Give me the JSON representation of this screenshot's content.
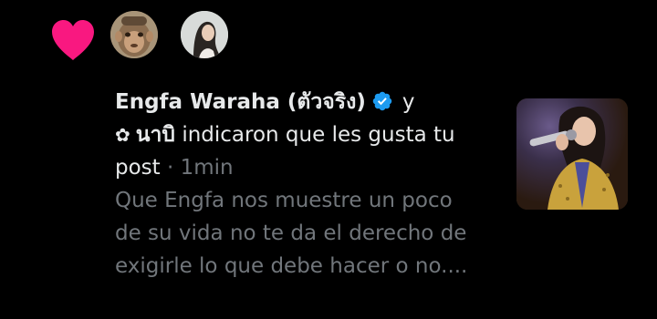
{
  "notification": {
    "type_icon": "heart-icon",
    "accent_color": "#f91880",
    "avatars": [
      {
        "icon": "monkey-avatar"
      },
      {
        "icon": "woman-avatar"
      }
    ],
    "user_name": "Engfa Waraha (ตัวจริง)",
    "verified_icon": "verified-badge-icon",
    "verified_color": "#1d9bf0",
    "conjunction": "y",
    "second_user_icon": "✿",
    "second_user_name": "นาบิ",
    "action_text": "indicaron que les gusta tu",
    "object_text": "post",
    "separator": "·",
    "timestamp": "1min",
    "excerpt_lines": [
      "Que Engfa nos muestre un poco",
      "de su vida no te da el derecho de",
      "exigirle lo que debe hacer o no...."
    ],
    "media_thumbnail": "singer-photo-thumbnail"
  }
}
